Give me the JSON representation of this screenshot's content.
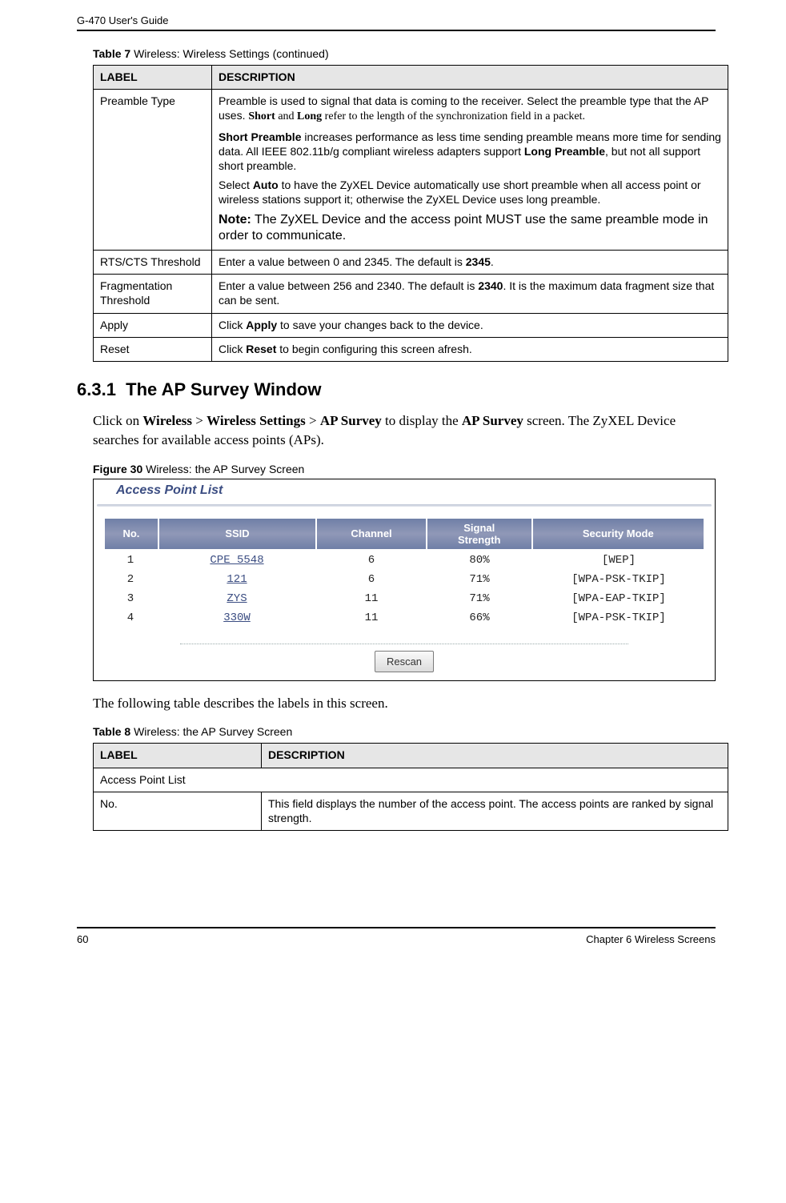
{
  "header": {
    "running": "G-470 User's Guide"
  },
  "tableCaption": {
    "prefix": "Table 7",
    "text": "   Wireless: Wireless Settings (continued)"
  },
  "settings": {
    "headers": {
      "label": "LABEL",
      "desc": "DESCRIPTION"
    },
    "rows": [
      {
        "label": "Preamble Type",
        "desc_part1a": "Preamble is used to signal that data is coming to the receiver. Select the preamble type that the AP uses. ",
        "desc_part1b": "Short",
        "desc_part1c": " and ",
        "desc_part1d": "Long",
        "desc_part1e": " refer to the length of the synchronization field in a packet.",
        "desc_part2a": "Short Preamble",
        "desc_part2b": " increases performance as less time sending preamble means more time for sending data. All IEEE 802.11b/g compliant wireless adapters support ",
        "desc_part2c": "Long Preamble",
        "desc_part2d": ", but not all support short preamble.",
        "desc_part3a": "Select ",
        "desc_part3b": "Auto",
        "desc_part3c": " to have the ZyXEL Device automatically use short preamble when all access point or wireless stations support it; otherwise the ZyXEL Device uses long preamble.",
        "desc_noteA": "Note:",
        "desc_noteB": " The ZyXEL Device and the access point MUST use the same preamble mode in order to communicate."
      },
      {
        "label": "RTS/CTS Threshold",
        "desc_a": "Enter a value between 0 and 2345. The default is ",
        "desc_b": "2345",
        "desc_c": "."
      },
      {
        "label": "Fragmentation Threshold",
        "desc_a": "Enter a value between 256 and 2340. The default is ",
        "desc_b": "2340",
        "desc_c": ". It is the maximum data fragment size that can be sent."
      },
      {
        "label": "Apply",
        "desc_a": "Click ",
        "desc_b": "Apply",
        "desc_c": " to save your changes back to the device."
      },
      {
        "label": "Reset",
        "desc_a": "Click ",
        "desc_b": "Reset",
        "desc_c": " to begin configuring this screen afresh."
      }
    ]
  },
  "section": {
    "number": "6.3.1",
    "title": "The AP Survey Window",
    "para_a": "Click on ",
    "para_b": "Wireless",
    "para_c": " > ",
    "para_d": "Wireless Settings",
    "para_e": " > ",
    "para_f": "AP Survey",
    "para_g": " to display the ",
    "para_h": "AP Survey",
    "para_i": " screen. The ZyXEL Device searches for available access points (APs)."
  },
  "figCaption": {
    "prefix": "Figure 30",
    "text": "   Wireless: the AP Survey Screen"
  },
  "apList": {
    "title": "Access Point List",
    "headers": {
      "no": "No.",
      "ssid": "SSID",
      "channel": "Channel",
      "signal_line1": "Signal",
      "signal_line2": "Strength",
      "mode": "Security Mode"
    },
    "rows": [
      {
        "no": "1",
        "ssid": "CPE 5548",
        "channel": "6",
        "signal": "80%",
        "mode": "[WEP]"
      },
      {
        "no": "2",
        "ssid": "121",
        "channel": "6",
        "signal": "71%",
        "mode": "[WPA-PSK-TKIP]"
      },
      {
        "no": "3",
        "ssid": "ZYS",
        "channel": "11",
        "signal": "71%",
        "mode": "[WPA-EAP-TKIP]"
      },
      {
        "no": "4",
        "ssid": "330W",
        "channel": "11",
        "signal": "66%",
        "mode": "[WPA-PSK-TKIP]"
      }
    ],
    "rescan": "Rescan"
  },
  "afterFigPara": "The following table describes the labels in this screen.",
  "table8Caption": {
    "prefix": "Table 8",
    "text": "   Wireless: the AP Survey Screen"
  },
  "table8": {
    "headers": {
      "label": "LABEL",
      "desc": "DESCRIPTION"
    },
    "rows": [
      {
        "label": "Access Point List",
        "desc": "",
        "span": true
      },
      {
        "label": "No.",
        "desc": "This field displays the number of the access point. The access points are ranked by signal strength."
      }
    ]
  },
  "footer": {
    "page": "60",
    "chapter": "Chapter 6 Wireless Screens"
  }
}
